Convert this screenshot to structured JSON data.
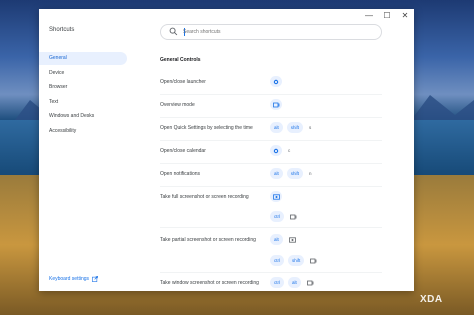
{
  "window": {
    "title": "Shortcuts",
    "controls": {
      "minimize": "—",
      "maximize": "☐",
      "close": "✕"
    }
  },
  "search": {
    "placeholder": "Search shortcuts",
    "value": ""
  },
  "sidebar": {
    "items": [
      {
        "label": "General",
        "active": true
      },
      {
        "label": "Device",
        "active": false
      },
      {
        "label": "Browser",
        "active": false
      },
      {
        "label": "Text",
        "active": false
      },
      {
        "label": "Windows and Desks",
        "active": false
      },
      {
        "label": "Accessibility",
        "active": false
      }
    ],
    "keyboard_settings_label": "Keyboard settings"
  },
  "main": {
    "section_title": "General Controls",
    "rows": [
      {
        "label": "Open/close launcher",
        "keys": [
          "launcher-icon"
        ]
      },
      {
        "label": "Overview mode",
        "keys": [
          "overview-icon"
        ]
      },
      {
        "label": "Open Quick Settings by selecting the time",
        "keys": [
          "alt",
          "shift",
          "s"
        ]
      },
      {
        "label": "Open/close calendar",
        "keys": [
          "launcher-icon",
          "c"
        ]
      },
      {
        "label": "Open notifications",
        "keys": [
          "alt",
          "shift",
          "n"
        ]
      },
      {
        "label": "Take full screenshot or screen recording",
        "keys": [
          "screenshot-icon"
        ],
        "keys2": [
          "ctrl",
          "overview-icon"
        ]
      },
      {
        "label": "Take partial screenshot or screen recording",
        "keys": [
          "alt",
          "screenshot-icon"
        ],
        "keys2": [
          "ctrl",
          "shift",
          "overview-icon"
        ]
      },
      {
        "label": "Take window screenshot or screen recording",
        "keys": [
          "ctrl",
          "alt",
          "overview-icon"
        ]
      }
    ]
  },
  "watermark": "XDA",
  "colors": {
    "accent": "#1a73e8",
    "chip_bg": "#e8f0fe",
    "active_nav_bg": "#e8f0fe"
  }
}
